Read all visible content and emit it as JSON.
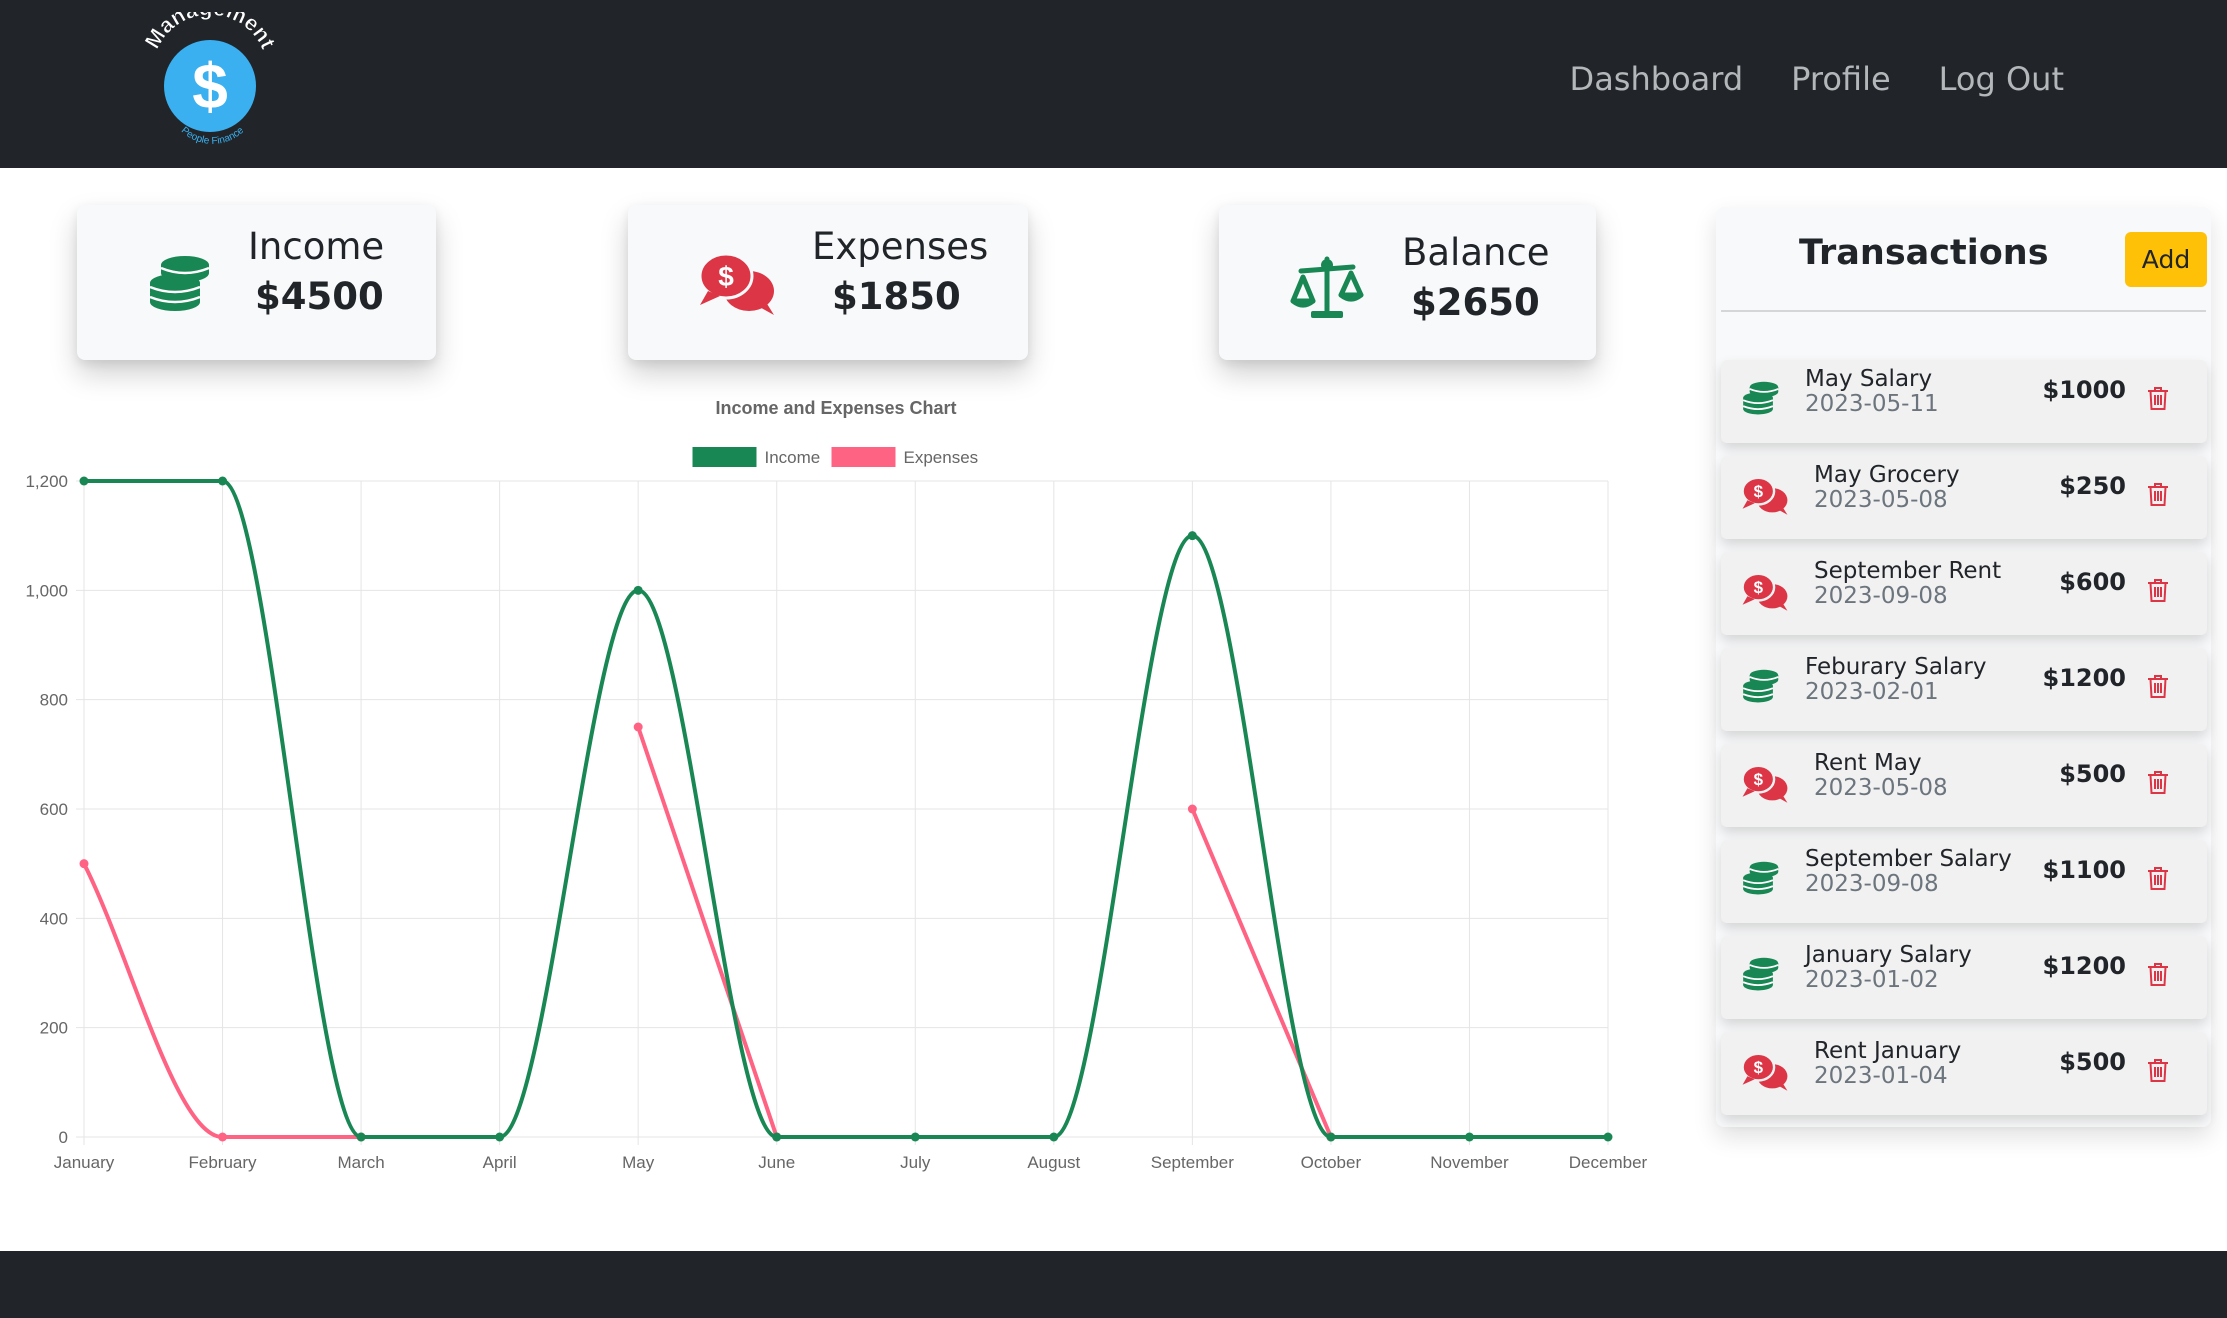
{
  "brand": {
    "logo_icon": "dollar-circle-logo",
    "logo_arc_text": "Management",
    "logo_sub_text": "People Finance",
    "logo_symbol": "$",
    "logo_color": "#3ab0f0"
  },
  "nav": {
    "items": [
      {
        "label": "Dashboard"
      },
      {
        "label": "Profile"
      },
      {
        "label": "Log Out"
      }
    ]
  },
  "summary": {
    "income": {
      "label": "Income",
      "value": "$4500",
      "icon": "coins-stack-icon",
      "color": "#198754"
    },
    "expenses": {
      "label": "Expenses",
      "value": "$1850",
      "icon": "dollar-chat-bubbles-icon",
      "color": "#dc3545"
    },
    "balance": {
      "label": "Balance",
      "value": "$2650",
      "icon": "balance-scale-icon",
      "color": "#198754"
    }
  },
  "chart_data": {
    "type": "line",
    "title": "Income and Expenses Chart",
    "categories": [
      "January",
      "February",
      "March",
      "April",
      "May",
      "June",
      "July",
      "August",
      "September",
      "October",
      "November",
      "December"
    ],
    "series": [
      {
        "name": "Income",
        "color": "#198754",
        "values": [
          1200,
          1200,
          0,
          0,
          1000,
          0,
          0,
          0,
          1100,
          0,
          0,
          0
        ]
      },
      {
        "name": "Expenses",
        "color": "#ff6384",
        "values": [
          500,
          0,
          0,
          null,
          750,
          0,
          null,
          null,
          600,
          0,
          null,
          null
        ]
      }
    ],
    "ylim": [
      0,
      1200
    ],
    "yticks": [
      "0",
      "200",
      "400",
      "600",
      "800",
      "1,000",
      "1,200"
    ],
    "grid": true,
    "legend": "top-center",
    "smooth": true
  },
  "transactions": {
    "title": "Transactions",
    "add_label": "Add",
    "items": [
      {
        "name": "May Salary",
        "date": "2023-05-11",
        "amount": "$1000",
        "type": "income",
        "icon": "coins-stack-icon"
      },
      {
        "name": "May Grocery",
        "date": "2023-05-08",
        "amount": "$250",
        "type": "expense",
        "icon": "dollar-chat-bubbles-icon"
      },
      {
        "name": "September Rent",
        "date": "2023-09-08",
        "amount": "$600",
        "type": "expense",
        "icon": "dollar-chat-bubbles-icon"
      },
      {
        "name": "Feburary Salary",
        "date": "2023-02-01",
        "amount": "$1200",
        "type": "income",
        "icon": "coins-stack-icon"
      },
      {
        "name": "Rent May",
        "date": "2023-05-08",
        "amount": "$500",
        "type": "expense",
        "icon": "dollar-chat-bubbles-icon"
      },
      {
        "name": "September Salary",
        "date": "2023-09-08",
        "amount": "$1100",
        "type": "income",
        "icon": "coins-stack-icon"
      },
      {
        "name": "January Salary",
        "date": "2023-01-02",
        "amount": "$1200",
        "type": "income",
        "icon": "coins-stack-icon"
      },
      {
        "name": "Rent January",
        "date": "2023-01-04",
        "amount": "$500",
        "type": "expense",
        "icon": "dollar-chat-bubbles-icon"
      }
    ],
    "delete_icon": "trash-icon",
    "delete_color": "#dc3545"
  }
}
